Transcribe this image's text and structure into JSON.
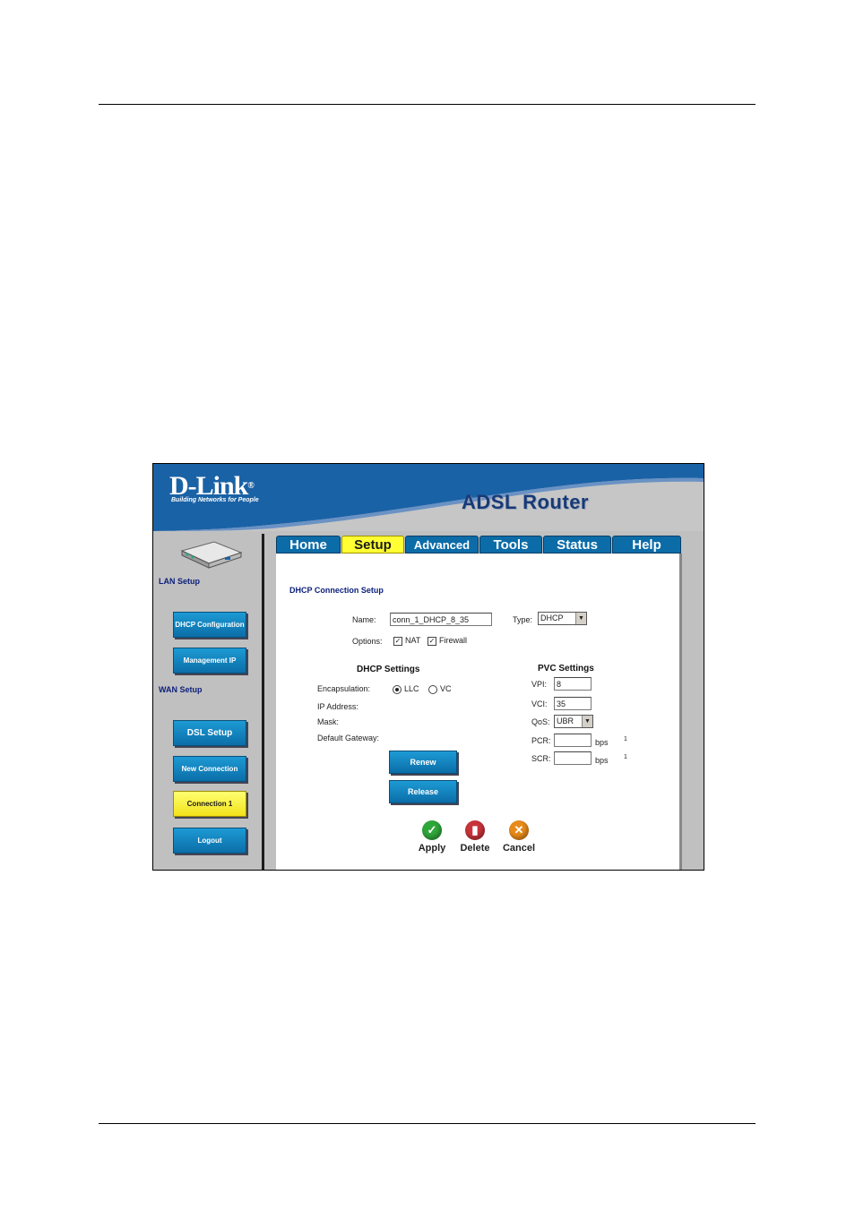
{
  "brand": {
    "logo": "D-Link",
    "tagline": "Building Networks for People",
    "product": "ADSL Router"
  },
  "tabs": [
    {
      "label": "Home",
      "active": false
    },
    {
      "label": "Setup",
      "active": true
    },
    {
      "label": "Advanced",
      "active": false
    },
    {
      "label": "Tools",
      "active": false
    },
    {
      "label": "Status",
      "active": false
    },
    {
      "label": "Help",
      "active": false
    }
  ],
  "sidebar": {
    "lan_label": "LAN Setup",
    "wan_label": "WAN Setup",
    "dhcp_config": "DHCP Configuration",
    "management_ip": "Management IP",
    "dsl_setup": "DSL Setup",
    "new_connection": "New Connection",
    "connection1": "Connection 1",
    "logout": "Logout"
  },
  "form": {
    "title": "DHCP Connection Setup",
    "name_label": "Name:",
    "name_value": "conn_1_DHCP_8_35",
    "type_label": "Type:",
    "type_value": "DHCP",
    "options_label": "Options:",
    "nat_label": "NAT",
    "firewall_label": "Firewall",
    "nat_checked": true,
    "firewall_checked": true
  },
  "dhcp": {
    "heading": "DHCP Settings",
    "encapsulation_label": "Encapsulation:",
    "llc_label": "LLC",
    "vc_label": "VC",
    "encapsulation_selected": "LLC",
    "ip_label": "IP Address:",
    "mask_label": "Mask:",
    "gateway_label": "Default Gateway:",
    "renew": "Renew",
    "release": "Release"
  },
  "pvc": {
    "heading": "PVC Settings",
    "vpi_label": "VPI:",
    "vpi_value": "8",
    "vci_label": "VCI:",
    "vci_value": "35",
    "qos_label": "QoS:",
    "qos_value": "UBR",
    "pcr_label": "PCR:",
    "pcr_value": "",
    "scr_label": "SCR:",
    "scr_value": "",
    "unit": "bps",
    "pcr_note": "1",
    "scr_note": "1"
  },
  "actions": {
    "apply": "Apply",
    "delete": "Delete",
    "cancel": "Cancel"
  },
  "colors": {
    "header_blue": "#1a62a6",
    "tab_blue": "#0c6ca8",
    "active_yellow": "#ffff33",
    "apply_green": "#2fa63a",
    "delete_red": "#c8333a",
    "cancel_orange": "#e88a1a"
  }
}
